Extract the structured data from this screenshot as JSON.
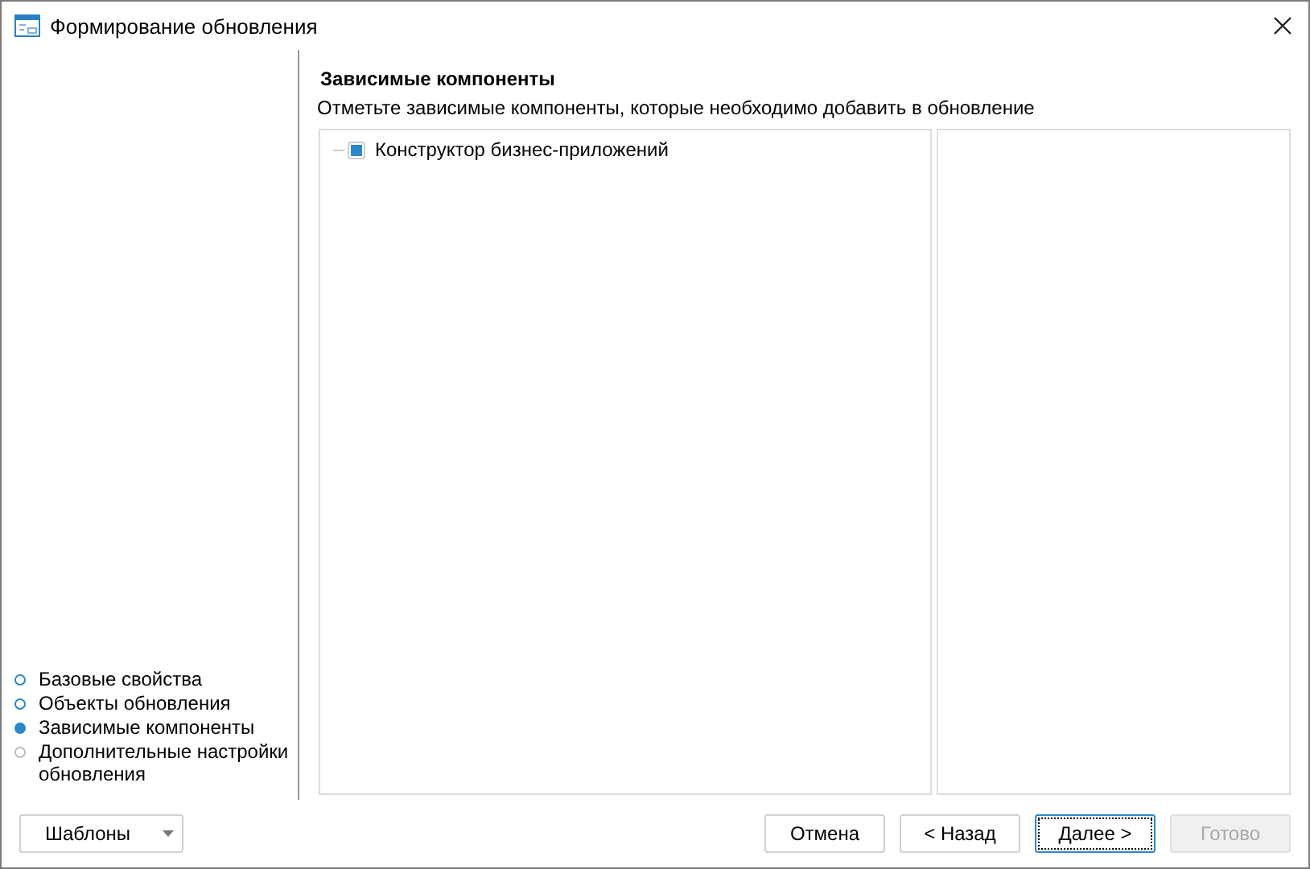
{
  "window": {
    "title": "Формирование обновления"
  },
  "steps": [
    {
      "label": "Базовые свойства",
      "kind": "done"
    },
    {
      "label": "Объекты обновления",
      "kind": "done"
    },
    {
      "label": "Зависимые компоненты",
      "kind": "current"
    },
    {
      "label": "Дополнительные настройки обновления",
      "kind": "pending"
    }
  ],
  "page": {
    "heading": "Зависимые компоненты",
    "description": "Отметьте зависимые компоненты, которые необходимо добавить в обновление"
  },
  "tree": [
    {
      "label": "Конструктор бизнес-приложений",
      "indeterminate": true
    }
  ],
  "templates_button": {
    "label": "Шаблоны"
  },
  "buttons": [
    {
      "label": "Отмена",
      "disabled": false,
      "focused": false
    },
    {
      "label": "< Назад",
      "disabled": false,
      "focused": false
    },
    {
      "label": "Далее >",
      "disabled": false,
      "focused": true
    },
    {
      "label": "Готово",
      "disabled": true,
      "focused": false
    }
  ]
}
